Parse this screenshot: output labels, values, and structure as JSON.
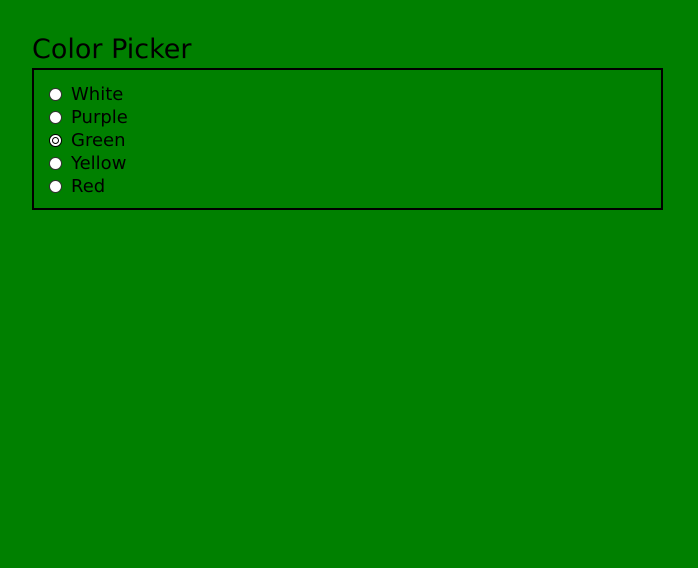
{
  "page": {
    "title": "Color Picker",
    "background_color": "#008000"
  },
  "options": [
    {
      "label": "White",
      "checked": false
    },
    {
      "label": "Purple",
      "checked": false
    },
    {
      "label": "Green",
      "checked": true
    },
    {
      "label": "Yellow",
      "checked": false
    },
    {
      "label": "Red",
      "checked": false
    }
  ],
  "selected_value": "Green"
}
